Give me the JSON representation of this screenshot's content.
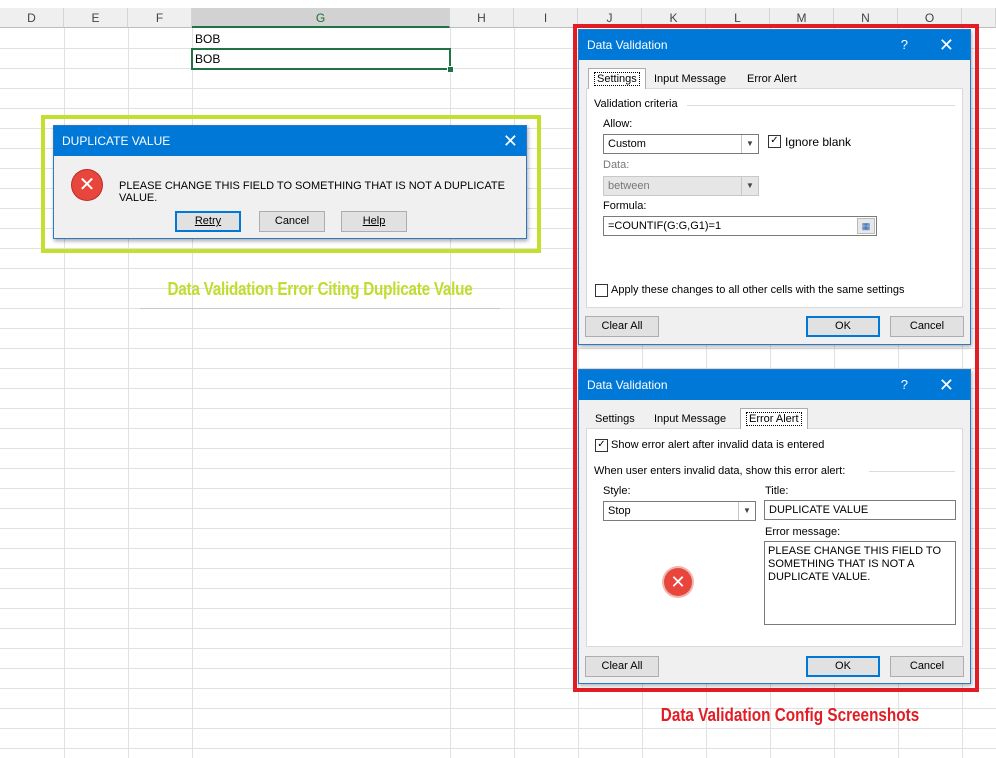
{
  "spreadsheet": {
    "columns": [
      "D",
      "E",
      "F",
      "G",
      "H",
      "I",
      "J",
      "K",
      "L",
      "M",
      "N",
      "O"
    ],
    "cells": [
      "BOB",
      "BOB"
    ]
  },
  "error_popup": {
    "title": "DUPLICATE VALUE",
    "message": "PLEASE CHANGE THIS FIELD TO SOMETHING THAT IS NOT A DUPLICATE VALUE.",
    "buttons": {
      "retry": "Retry",
      "cancel": "Cancel",
      "help": "Help"
    },
    "close": "✕"
  },
  "caption_left": "Data Validation Error Citing Duplicate Value",
  "caption_right": "Data Validation Config Screenshots",
  "dialog_settings": {
    "title": "Data Validation",
    "help": "?",
    "close": "✕",
    "tabs": [
      "Settings",
      "Input Message",
      "Error Alert"
    ],
    "group": "Validation criteria",
    "allow_label": "Allow:",
    "allow_value": "Custom",
    "ignore_blank": "Ignore blank",
    "data_label": "Data:",
    "data_value": "between",
    "formula_label": "Formula:",
    "formula_value": "=COUNTIF(G:G,G1)=1",
    "apply_all": "Apply these changes to all other cells with the same settings",
    "clear_all": "Clear All",
    "ok": "OK",
    "cancel": "Cancel"
  },
  "dialog_error": {
    "title": "Data Validation",
    "help": "?",
    "close": "✕",
    "tabs": [
      "Settings",
      "Input Message",
      "Error Alert"
    ],
    "show_alert": "Show error alert after invalid data is entered",
    "group": "When user enters invalid data, show this error alert:",
    "style_label": "Style:",
    "style_value": "Stop",
    "title_label": "Title:",
    "title_value": "DUPLICATE VALUE",
    "msg_label": "Error message:",
    "msg_value": "PLEASE CHANGE THIS FIELD TO\nSOMETHING THAT IS NOT A\nDUPLICATE VALUE.",
    "clear_all": "Clear All",
    "ok": "OK",
    "cancel": "Cancel"
  },
  "colors": {
    "excel_green": "#217346",
    "highlight_green": "#c2e030",
    "frame_red": "#e21d25",
    "title_blue": "#0078d7"
  }
}
